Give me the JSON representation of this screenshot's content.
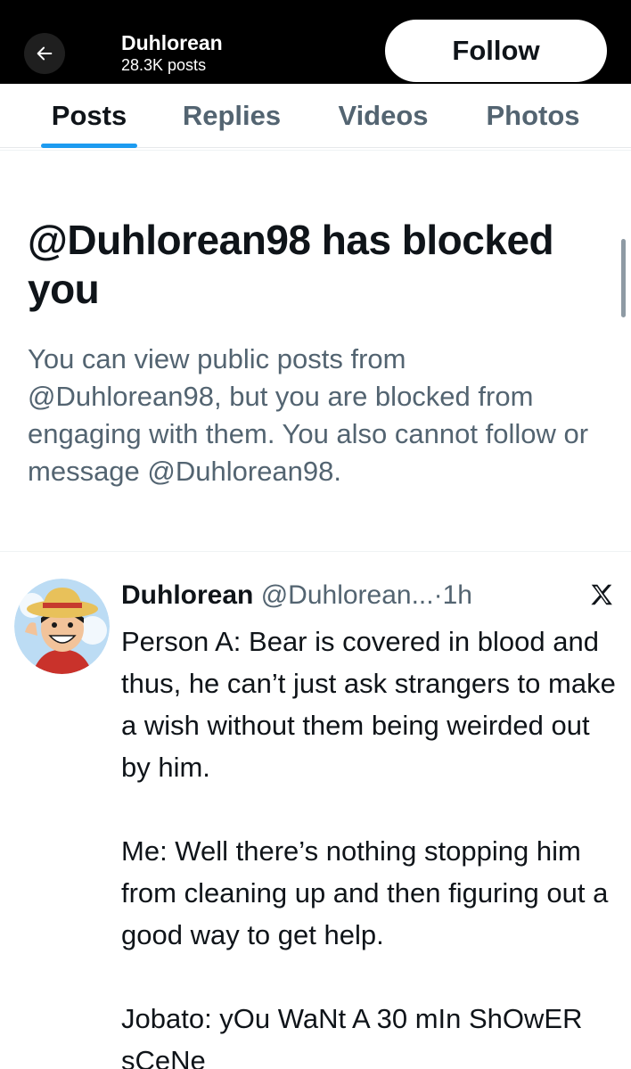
{
  "header": {
    "name": "Duhlorean",
    "post_count": "28.3K posts",
    "follow_label": "Follow"
  },
  "tabs": [
    {
      "label": "Posts",
      "active": true
    },
    {
      "label": "Replies",
      "active": false
    },
    {
      "label": "Videos",
      "active": false
    },
    {
      "label": "Photos",
      "active": false
    }
  ],
  "blocked": {
    "title": "@Duhlorean98 has blocked you",
    "description": "You can view public posts from @Duhlorean98, but you are blocked from engaging with them. You also cannot follow or message @Duhlorean98."
  },
  "post": {
    "author_name": "Duhlorean",
    "author_handle": "@Duhlorean...",
    "separator": "·",
    "time": "1h",
    "paragraphs": [
      "Person A: Bear is covered in blood and thus, he can’t just ask strangers to make a wish without them being weirded out by him.",
      "Me: Well there’s nothing stopping him from cleaning up and then figuring out a good way to get help.",
      "Jobato: yOu WaNt A 30 mIn ShOwER sCeNe"
    ]
  },
  "icons": {
    "back": "back-arrow-icon",
    "platform": "x-logo-icon",
    "avatar": "avatar"
  },
  "colors": {
    "accent": "#1d9bf0",
    "header_bg": "#000000",
    "secondary_text": "#536471",
    "primary_text": "#0f1419"
  }
}
